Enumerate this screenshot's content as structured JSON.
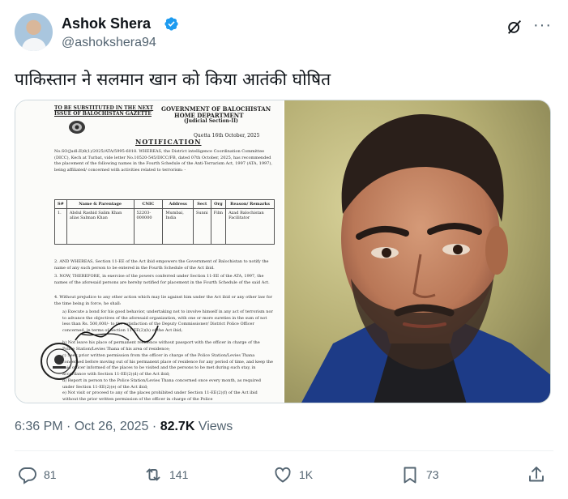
{
  "author": {
    "name": "Ashok Shera",
    "handle": "@ashokshera94"
  },
  "tweet": {
    "text": "पाकिस्तान ने सलमान खान को किया आतंकी घोषित"
  },
  "document": {
    "top_left_line1": "TO BE SUBSTITUTED IN THE NEXT",
    "top_left_line2": "ISSUE OF BALOCHISTAN GAZETTE",
    "top_right_line1": "GOVERNMENT OF BALOCHISTAN",
    "top_right_line2": "HOME DEPARTMENT",
    "top_right_line3": "(Judicial Section-II)",
    "title": "NOTIFICATION",
    "date": "Quetta 16th October, 2025",
    "para1": "No.SO(Judl:II)8(1)/2025/ATA/5995-6018. WHEREAS, the District intelligence Coordination Committee (DICC), Kech at Turbat, vide letter No.10520-545/DICC/FB, dated 07th October, 2025, has recommended the placement of the following names in the Fourth Schedule of the Anti-Terrarism Act, 1997 (ATA, 1997), being affiliated/ concerned with activities related to terrorism: -",
    "table_headers": [
      "S#",
      "Name & Parentage",
      "CNIC",
      "Address",
      "Sect",
      "Org",
      "Reason/ Remarks"
    ],
    "table_row": [
      "1.",
      "Abdul Rashid Salim Khan alias Salman Khan",
      "52203-000000",
      "Mumbai, India",
      "Sunni",
      "Film",
      "Azad Balochistan Facilitator"
    ],
    "para2": "2. AND WHEREAS, Section 11-EE of the Act ibid empowers the Government of Balochistan to notify the name of any such person to be entered in the Fourth Schedule of the Act ibid.",
    "para3": "3. NOW, THEREFORE, in exercise of the powers conferred under Section 11-EE of the ATA, 1997, the names of the aforesaid persons are hereby notified for placement in the Fourth Schedule of the said Act.",
    "para4": "4. Without prejudice to any other action which may lie against him under the Act ibid or any other law for the time being in force, he shall:",
    "para5": "a) Execute a bond for his good behavior, undertaking not to involve himself in any act of terrorism nor to advance the objectives of the aforesaid organization, with one or more sureties in the sum of not less than Rs. 500,000/- to the satisfaction of the Deputy Commissioner/ District Police Officer concerned, in terms of Section 11-EE(2)(b) of the Act ibid;",
    "para6": "b) Not leave his place of permanent residence without passport with the officer in charge of the Police Station/Levies Thana of his area of residence;",
    "para7": "c) Seek prior written permission from the officer in charge of the Police Station/Levies Thana concerned before moving out of his permanent place of residence for any period of time, and keep the said officer informed of the places to be visited and the persons to be met during such stay, in accordance with Section 11-EE(2)(d) of the Act ibid;",
    "para8": "d) Report in person to the Police Station/Levies Thana concerned once every month, as required under Section 11-EE(2)(e) of the Act ibid;",
    "para9": "e) Not visit or proceed to any of the places prohibited under Section 11-EE(2)(f) of the Act ibid without the prior written permission of the officer in charge of the Police"
  },
  "meta": {
    "time": "6:36 PM",
    "separator": "·",
    "date": "Oct 26, 2025",
    "views_count": "82.7K",
    "views_label": "Views"
  },
  "actions": {
    "replies": "81",
    "reposts": "141",
    "likes": "1K",
    "bookmarks": "73"
  },
  "colors": {
    "text_primary": "#0f1419",
    "text_secondary": "#536471",
    "verified_blue": "#1d9bf0",
    "border": "#cfd9de"
  },
  "icons": [
    "verified-badge-icon",
    "grok-icon",
    "more-options-icon",
    "reply-icon",
    "repost-icon",
    "like-icon",
    "bookmark-icon",
    "share-icon"
  ]
}
